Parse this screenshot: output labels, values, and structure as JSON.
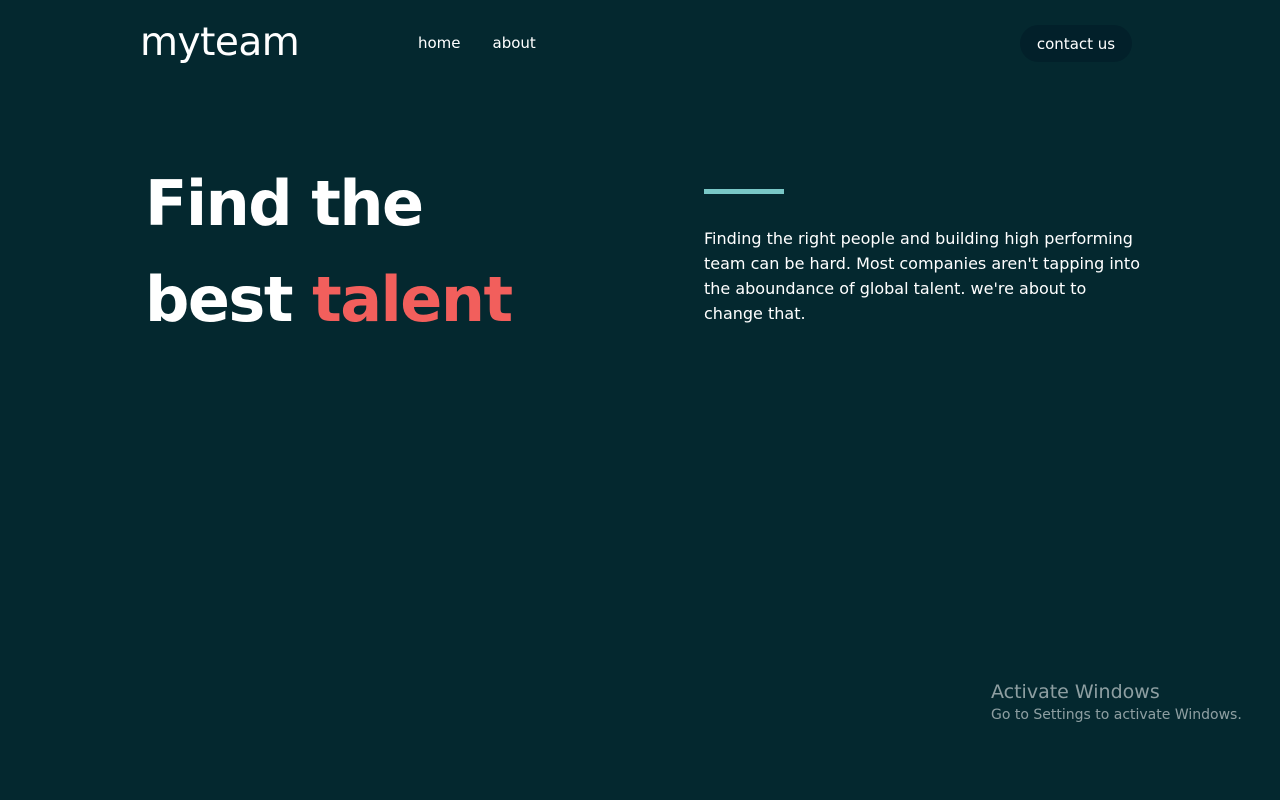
{
  "header": {
    "logo": "myteam",
    "nav": [
      {
        "label": "home"
      },
      {
        "label": "about"
      }
    ],
    "contact_label": "contact us"
  },
  "hero": {
    "title_line1": "Find the",
    "title_line2_prefix": "best ",
    "title_accent": "talent",
    "description": "Finding the right people and building high performing team can be hard. Most companies aren't tapping into the aboundance of global talent. we're about to change that."
  },
  "watermark": {
    "title": "Activate Windows",
    "subtitle": "Go to Settings to activate Windows."
  },
  "colors": {
    "background": "#04282f",
    "accent": "#f25f5c",
    "rule": "#79c8c7",
    "button_bg": "#02202a"
  }
}
